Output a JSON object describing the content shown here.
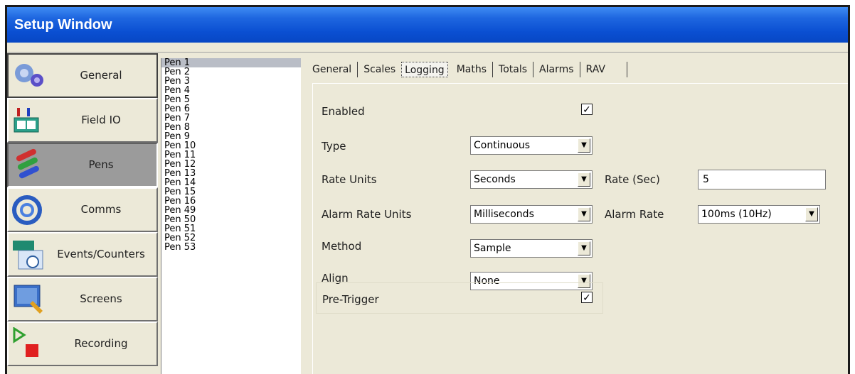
{
  "window": {
    "title": "Setup Window"
  },
  "nav": {
    "items": [
      {
        "label": "General",
        "icon": "gears-icon"
      },
      {
        "label": "Field IO",
        "icon": "field-io-icon"
      },
      {
        "label": "Pens",
        "icon": "pens-icon",
        "active": true
      },
      {
        "label": "Comms",
        "icon": "comms-icon"
      },
      {
        "label": "Events/Counters",
        "icon": "events-counters-icon"
      },
      {
        "label": "Screens",
        "icon": "screens-icon"
      },
      {
        "label": "Recording",
        "icon": "recording-icon"
      }
    ]
  },
  "pens": [
    "Pen 1",
    "Pen 2",
    "Pen 3",
    "Pen 4",
    "Pen 5",
    "Pen 6",
    "Pen 7",
    "Pen 8",
    "Pen 9",
    "Pen 10",
    "Pen 11",
    "Pen 12",
    "Pen 13",
    "Pen 14",
    "Pen 15",
    "Pen 16",
    "Pen 49",
    "Pen 50",
    "Pen 51",
    "Pen 52",
    "Pen 53"
  ],
  "selected_pen": "Pen 1",
  "tabs": [
    "General",
    "Scales",
    "Logging",
    "Maths",
    "Totals",
    "Alarms",
    "RAV"
  ],
  "active_tab": "Logging",
  "logging": {
    "enabled_label": "Enabled",
    "enabled_checked": "✓",
    "type_label": "Type",
    "type_value": "Continuous",
    "rate_units_label": "Rate Units",
    "rate_units_value": "Seconds",
    "rate_label": "Rate (Sec)",
    "rate_value": "5",
    "alarm_rate_units_label": "Alarm Rate Units",
    "alarm_rate_units_value": "Milliseconds",
    "alarm_rate_label": "Alarm Rate",
    "alarm_rate_value": "100ms (10Hz)",
    "method_label": "Method",
    "method_value": "Sample",
    "align_label": "Align",
    "align_value": "None",
    "pretrigger_label": "Pre-Trigger",
    "pretrigger_checked": "✓"
  },
  "dropdown_arrow": "▼"
}
